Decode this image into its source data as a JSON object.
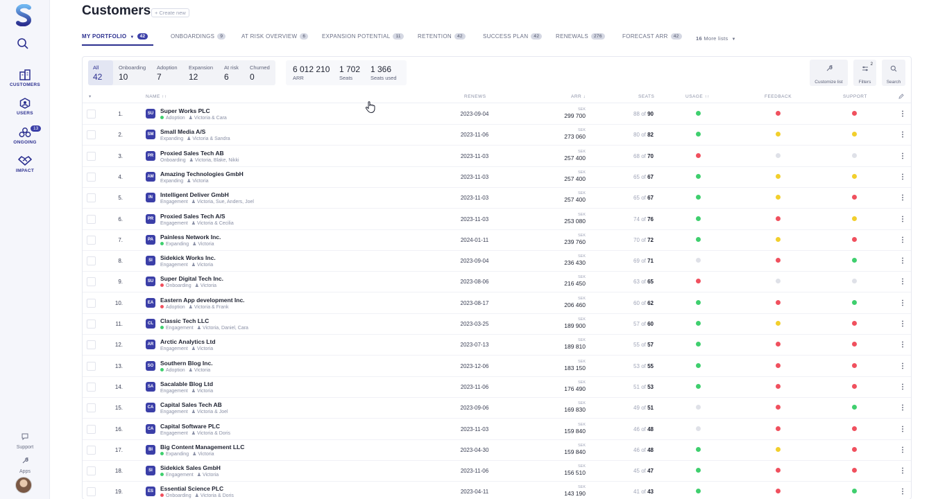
{
  "sidebar": {
    "items": [
      {
        "label": "CUSTOMERS",
        "icon": "building-icon"
      },
      {
        "label": "USERS",
        "icon": "user-icon"
      },
      {
        "label": "ONGOING",
        "icon": "group-icon",
        "badge": "13"
      },
      {
        "label": "IMPACT",
        "icon": "handshake-icon"
      }
    ],
    "support_label": "Support",
    "apps_label": "Apps"
  },
  "header": {
    "title": "Customers",
    "create_new": "+ Create new"
  },
  "tabs": [
    {
      "label": "MY PORTFOLIO",
      "count": "42",
      "active": true
    },
    {
      "label": "ONBOARDINGS",
      "count": "9"
    },
    {
      "label": "AT RISK OVERVIEW",
      "count": "6"
    },
    {
      "label": "EXPANSION POTENTIAL",
      "count": "11"
    },
    {
      "label": "RETENTION",
      "count": "42"
    },
    {
      "label": "SUCCESS PLAN",
      "count": "42"
    },
    {
      "label": "RENEWALS",
      "count": "276"
    },
    {
      "label": "FORECAST ARR",
      "count": "42"
    }
  ],
  "more_lists": {
    "count": "16",
    "label": "More lists"
  },
  "segments": [
    {
      "label": "All",
      "value": "42"
    },
    {
      "label": "Onboarding",
      "value": "10"
    },
    {
      "label": "Adoption",
      "value": "7"
    },
    {
      "label": "Expansion",
      "value": "12"
    },
    {
      "label": "At risk",
      "value": "6"
    },
    {
      "label": "Churned",
      "value": "0"
    }
  ],
  "metrics": [
    {
      "value": "6 012 210",
      "label": "ARR"
    },
    {
      "value": "1 702",
      "label": "Seats"
    },
    {
      "value": "1 366",
      "label": "Seats used"
    }
  ],
  "tools": {
    "customize": "Customize list",
    "filters": "Filters",
    "filters_count": "2",
    "search": "Search"
  },
  "columns": {
    "name": "NAME ↑↑",
    "renews": "RENEWS",
    "arr": "ARR ↓",
    "seats": "SEATS",
    "usage": "USAGE ↑↑",
    "feedback": "FEEDBACK",
    "support": "SUPPORT"
  },
  "colors": {
    "green": "#3fcf6e",
    "red": "#f0505e",
    "yellow": "#f2cf2c",
    "grey": "#dfe1e8",
    "accent": "#2b2f8f"
  },
  "rows": [
    {
      "num": "1.",
      "abbr": "SU",
      "name": "Super Works PLC",
      "stage": "Adoption",
      "stage_color": "#3fcf6e",
      "people": "Victoria & Cara",
      "renews": "2023-09-04",
      "currency": "SEK",
      "arr": "299 700",
      "used": "88",
      "of": "of",
      "total": "90",
      "usage": "green",
      "feedback": "red",
      "support": "red"
    },
    {
      "num": "2.",
      "abbr": "SM",
      "name": "Small Media A/S",
      "stage": "Expanding",
      "stage_color": "",
      "people": "Victoria & Sandra",
      "renews": "2023-11-06",
      "currency": "SEK",
      "arr": "273 060",
      "used": "80",
      "of": "of",
      "total": "82",
      "usage": "green",
      "feedback": "yellow",
      "support": "yellow"
    },
    {
      "num": "3.",
      "abbr": "PR",
      "name": "Proxied Sales Tech AB",
      "stage": "Onboarding",
      "stage_color": "",
      "people": "Victoria, Blake, Nikki",
      "renews": "2023-11-03",
      "currency": "SEK",
      "arr": "257 400",
      "used": "68",
      "of": "of",
      "total": "70",
      "usage": "red",
      "feedback": "grey",
      "support": "grey"
    },
    {
      "num": "4.",
      "abbr": "AM",
      "name": "Amazing Technologies GmbH",
      "stage": "Expanding",
      "stage_color": "",
      "people": "Victoria",
      "renews": "2023-11-03",
      "currency": "SEK",
      "arr": "257 400",
      "used": "65",
      "of": "of",
      "total": "67",
      "usage": "green",
      "feedback": "yellow",
      "support": "yellow"
    },
    {
      "num": "5.",
      "abbr": "IN",
      "name": "Intelligent Deliver GmbH",
      "stage": "Engagement",
      "stage_color": "",
      "people": "Victoria, Sue, Anders, Joel",
      "renews": "2023-11-03",
      "currency": "SEK",
      "arr": "257 400",
      "used": "65",
      "of": "of",
      "total": "67",
      "usage": "green",
      "feedback": "yellow",
      "support": "red"
    },
    {
      "num": "6.",
      "abbr": "PR",
      "name": "Proxied Sales Tech A/S",
      "stage": "Engagement",
      "stage_color": "",
      "people": "Victoria & Cecilia",
      "renews": "2023-11-03",
      "currency": "SEK",
      "arr": "253 080",
      "used": "74",
      "of": "of",
      "total": "76",
      "usage": "green",
      "feedback": "red",
      "support": "yellow"
    },
    {
      "num": "7.",
      "abbr": "PA",
      "name": "Painless Network Inc.",
      "stage": "Expanding",
      "stage_color": "#3fcf6e",
      "people": "Victoria",
      "renews": "2024-01-11",
      "currency": "SEK",
      "arr": "239 760",
      "used": "70",
      "of": "of",
      "total": "72",
      "usage": "green",
      "feedback": "yellow",
      "support": "red"
    },
    {
      "num": "8.",
      "abbr": "SI",
      "name": "Sidekick Works Inc.",
      "stage": "Engagement",
      "stage_color": "",
      "people": "Victoria",
      "renews": "2023-09-04",
      "currency": "SEK",
      "arr": "236 430",
      "used": "69",
      "of": "of",
      "total": "71",
      "usage": "grey",
      "feedback": "red",
      "support": "green"
    },
    {
      "num": "9.",
      "abbr": "SU",
      "name": "Super Digital Tech Inc.",
      "stage": "Onboarding",
      "stage_color": "#f0505e",
      "people": "Victoria",
      "renews": "2023-08-06",
      "currency": "SEK",
      "arr": "216 450",
      "used": "63",
      "of": "of",
      "total": "65",
      "usage": "red",
      "feedback": "grey",
      "support": "grey"
    },
    {
      "num": "10.",
      "abbr": "EA",
      "name": "Eastern App development Inc.",
      "stage": "Adoption",
      "stage_color": "#f0505e",
      "people": "Victoria & Frank",
      "renews": "2023-08-17",
      "currency": "SEK",
      "arr": "206 460",
      "used": "60",
      "of": "of",
      "total": "62",
      "usage": "green",
      "feedback": "red",
      "support": "green"
    },
    {
      "num": "11.",
      "abbr": "CL",
      "name": "Classic Tech LLC",
      "stage": "Engagement",
      "stage_color": "#3fcf6e",
      "people": "Victoria, Daniel, Cara",
      "renews": "2023-03-25",
      "currency": "SEK",
      "arr": "189 900",
      "used": "57",
      "of": "of",
      "total": "60",
      "usage": "green",
      "feedback": "yellow",
      "support": "red"
    },
    {
      "num": "12.",
      "abbr": "AR",
      "name": "Arctic Analytics Ltd",
      "stage": "Engagement",
      "stage_color": "",
      "people": "Victoria",
      "renews": "2023-07-13",
      "currency": "SEK",
      "arr": "189 810",
      "used": "55",
      "of": "of",
      "total": "57",
      "usage": "green",
      "feedback": "red",
      "support": "red"
    },
    {
      "num": "13.",
      "abbr": "SO",
      "name": "Southern Blog Inc.",
      "stage": "Adoption",
      "stage_color": "#3fcf6e",
      "people": "Victoria",
      "renews": "2023-12-06",
      "currency": "SEK",
      "arr": "183 150",
      "used": "53",
      "of": "of",
      "total": "55",
      "usage": "green",
      "feedback": "red",
      "support": "red"
    },
    {
      "num": "14.",
      "abbr": "SA",
      "name": "Sacalable Blog Ltd",
      "stage": "Engagement",
      "stage_color": "",
      "people": "Victoria",
      "renews": "2023-11-06",
      "currency": "SEK",
      "arr": "176 490",
      "used": "51",
      "of": "of",
      "total": "53",
      "usage": "green",
      "feedback": "red",
      "support": "red"
    },
    {
      "num": "15.",
      "abbr": "CA",
      "name": "Capital Sales Tech AB",
      "stage": "Engagement",
      "stage_color": "",
      "people": "Victoria & Joel",
      "renews": "2023-09-06",
      "currency": "SEK",
      "arr": "169 830",
      "used": "49",
      "of": "of",
      "total": "51",
      "usage": "grey",
      "feedback": "red",
      "support": "green"
    },
    {
      "num": "16.",
      "abbr": "CA",
      "name": "Capital Software PLC",
      "stage": "Engagement",
      "stage_color": "",
      "people": "Victoria & Doris",
      "renews": "2023-11-03",
      "currency": "SEK",
      "arr": "159 840",
      "used": "46",
      "of": "of",
      "total": "48",
      "usage": "grey",
      "feedback": "red",
      "support": "red"
    },
    {
      "num": "17.",
      "abbr": "BI",
      "name": "Big Content Management LLC",
      "stage": "Expanding",
      "stage_color": "#3fcf6e",
      "people": "Victoria",
      "renews": "2023-04-30",
      "currency": "SEK",
      "arr": "159 840",
      "used": "46",
      "of": "of",
      "total": "48",
      "usage": "green",
      "feedback": "yellow",
      "support": "red"
    },
    {
      "num": "18.",
      "abbr": "SI",
      "name": "Sidekick Sales GmbH",
      "stage": "Engagement",
      "stage_color": "#3fcf6e",
      "people": "Victoria",
      "renews": "2023-11-06",
      "currency": "SEK",
      "arr": "156 510",
      "used": "45",
      "of": "of",
      "total": "47",
      "usage": "green",
      "feedback": "red",
      "support": "red"
    },
    {
      "num": "19.",
      "abbr": "ES",
      "name": "Essential Science PLC",
      "stage": "Onboarding",
      "stage_color": "#f0505e",
      "people": "Victoria & Doris",
      "renews": "2023-04-11",
      "currency": "SEK",
      "arr": "143 190",
      "used": "41",
      "of": "of",
      "total": "43",
      "usage": "green",
      "feedback": "red",
      "support": "green"
    }
  ]
}
